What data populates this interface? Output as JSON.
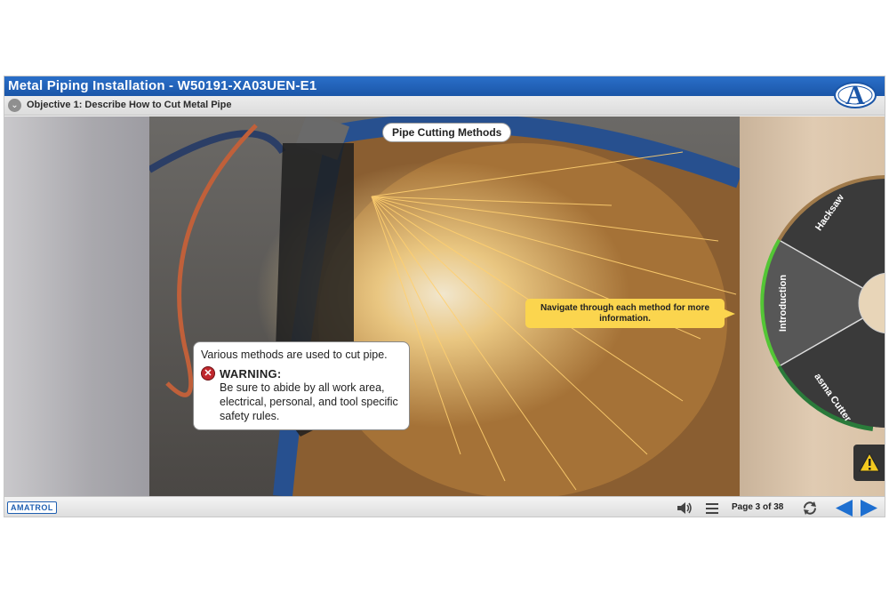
{
  "app": {
    "title": "Metal Piping Installation - W50191-XA03UEN-E1",
    "logo_letter": "A"
  },
  "objective": {
    "text": "Objective 1: Describe How to Cut Metal Pipe"
  },
  "slide": {
    "heading": "Pipe Cutting Methods",
    "info_intro": "Various methods are used to cut pipe.",
    "warning_title": "WARNING:",
    "warning_text": "Be sure to abide by all work area, electrical, personal, and tool specific safety rules.",
    "nav_hint": "Navigate through each method for more information."
  },
  "wheel": {
    "segments": [
      {
        "label": "Hacksaw"
      },
      {
        "label": "Introduction",
        "active": true
      },
      {
        "label": "asma Cutter"
      }
    ]
  },
  "footer": {
    "brand": "AMATROL",
    "page_label": "Page 3 of 38"
  },
  "colors": {
    "title_bar": "#1b56a8",
    "accent_yellow": "#fbd54e",
    "nav_blue": "#1e6fd0",
    "active_ring": "#53c635",
    "ring_green": "#2a7a3a"
  }
}
